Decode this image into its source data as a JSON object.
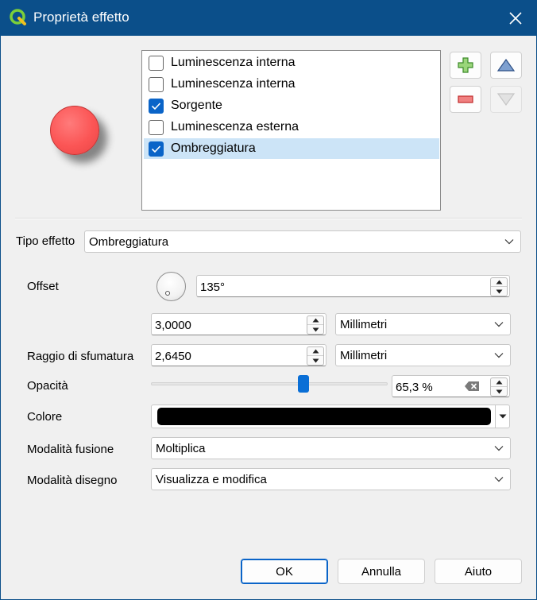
{
  "window": {
    "title": "Proprietà effetto",
    "app_icon": "qgis-logo-icon",
    "close_icon": "close-icon"
  },
  "preview": {
    "shape": "circle",
    "fill_color": "#fb5555"
  },
  "effects_list": {
    "items": [
      {
        "label": "Luminescenza interna",
        "checked": false,
        "selected": false
      },
      {
        "label": "Luminescenza interna",
        "checked": false,
        "selected": false
      },
      {
        "label": "Sorgente",
        "checked": true,
        "selected": false
      },
      {
        "label": "Luminescenza esterna",
        "checked": false,
        "selected": false
      },
      {
        "label": "Ombreggiatura",
        "checked": true,
        "selected": true
      }
    ]
  },
  "toolbar": {
    "add_icon": "add-plus-icon",
    "remove_icon": "remove-minus-icon",
    "move_up_icon": "triangle-up-icon",
    "move_down_icon": "triangle-down-icon"
  },
  "effect_type": {
    "label": "Tipo effetto",
    "value": "Ombreggiatura"
  },
  "offset": {
    "label": "Offset",
    "angle": "135°",
    "distance": "3,0000",
    "distance_unit": "Millimetri"
  },
  "blur": {
    "label": "Raggio di sfumatura",
    "value": "2,6450",
    "unit": "Millimetri"
  },
  "opacity": {
    "label": "Opacità",
    "value": "65,3 %",
    "slider_fraction": 0.653
  },
  "color": {
    "label": "Colore",
    "value": "#000000"
  },
  "blend_mode": {
    "label": "Modalità fusione",
    "value": "Moltiplica"
  },
  "draw_mode": {
    "label": "Modalità disegno",
    "value": "Visualizza e modifica"
  },
  "buttons": {
    "ok": "OK",
    "cancel": "Annulla",
    "help": "Aiuto"
  },
  "colors": {
    "titlebar": "#0b4f8a",
    "accent": "#0a64c8",
    "selection": "#cce4f7"
  }
}
